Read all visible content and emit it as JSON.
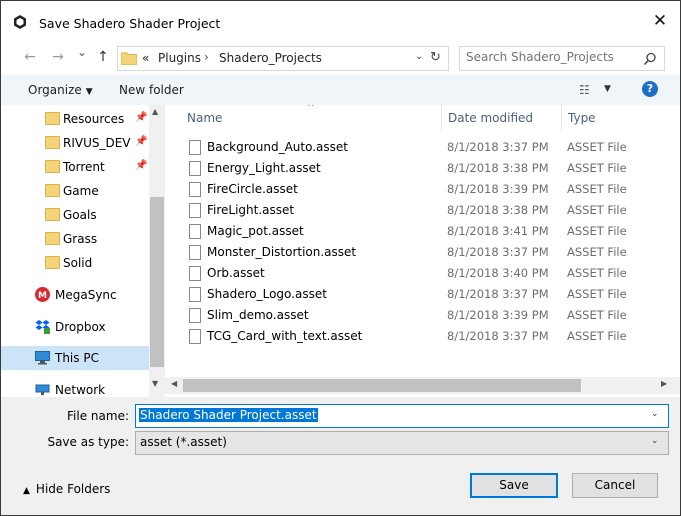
{
  "window": {
    "title": "Save Shadero Shader Project",
    "close_glyph": "✕"
  },
  "nav": {
    "back": "←",
    "forward": "→",
    "history": "⌄",
    "up": "↑",
    "breadcrumb_overflow": "«",
    "breadcrumb": [
      "Plugins",
      "Shadero_Projects"
    ],
    "breadcrumb_sep": "›",
    "refresh": "↻",
    "search_placeholder": "Search Shadero_Projects"
  },
  "toolbar": {
    "organize": "Organize",
    "new_folder": "New folder",
    "help": "?"
  },
  "sidebar": {
    "items": [
      {
        "label": "Resources",
        "icon": "folder-icon",
        "pinned": true
      },
      {
        "label": "RIVUS_DEV",
        "icon": "folder-icon",
        "pinned": true
      },
      {
        "label": "Torrent",
        "icon": "folder-icon",
        "pinned": true
      },
      {
        "label": "Game",
        "icon": "folder-icon",
        "pinned": false
      },
      {
        "label": "Goals",
        "icon": "folder-icon",
        "pinned": false
      },
      {
        "label": "Grass",
        "icon": "folder-icon",
        "pinned": false
      },
      {
        "label": "Solid",
        "icon": "folder-icon",
        "pinned": false
      }
    ],
    "locations": [
      {
        "label": "MegaSync",
        "icon": "megasync-icon"
      },
      {
        "label": "Dropbox",
        "icon": "dropbox-icon"
      },
      {
        "label": "This PC",
        "icon": "this-pc-icon",
        "selected": true
      },
      {
        "label": "Network",
        "icon": "network-icon"
      }
    ]
  },
  "files": {
    "columns": {
      "name": "Name",
      "date": "Date modified",
      "type": "Type"
    },
    "rows": [
      {
        "name": "Background_Auto.asset",
        "date": "8/1/2018 3:37 PM",
        "type": "ASSET File"
      },
      {
        "name": "Energy_Light.asset",
        "date": "8/1/2018 3:38 PM",
        "type": "ASSET File"
      },
      {
        "name": "FireCircle.asset",
        "date": "8/1/2018 3:39 PM",
        "type": "ASSET File"
      },
      {
        "name": "FireLight.asset",
        "date": "8/1/2018 3:38 PM",
        "type": "ASSET File"
      },
      {
        "name": "Magic_pot.asset",
        "date": "8/1/2018 3:41 PM",
        "type": "ASSET File"
      },
      {
        "name": "Monster_Distortion.asset",
        "date": "8/1/2018 3:37 PM",
        "type": "ASSET File"
      },
      {
        "name": "Orb.asset",
        "date": "8/1/2018 3:40 PM",
        "type": "ASSET File"
      },
      {
        "name": "Shadero_Logo.asset",
        "date": "8/1/2018 3:37 PM",
        "type": "ASSET File"
      },
      {
        "name": "Slim_demo.asset",
        "date": "8/1/2018 3:39 PM",
        "type": "ASSET File"
      },
      {
        "name": "TCG_Card_with_text.asset",
        "date": "8/1/2018 3:37 PM",
        "type": "ASSET File"
      }
    ]
  },
  "form": {
    "file_name_label": "File name:",
    "file_name_value": "Shadero Shader Project.asset",
    "save_type_label": "Save as type:",
    "save_type_value": "asset (*.asset)"
  },
  "footer": {
    "hide_folders": "Hide Folders",
    "save": "Save",
    "cancel": "Cancel"
  },
  "colors": {
    "accent": "#0078d7",
    "selection": "#cce4f7",
    "help": "#1c6fc6",
    "folder": "#f5d37a"
  }
}
